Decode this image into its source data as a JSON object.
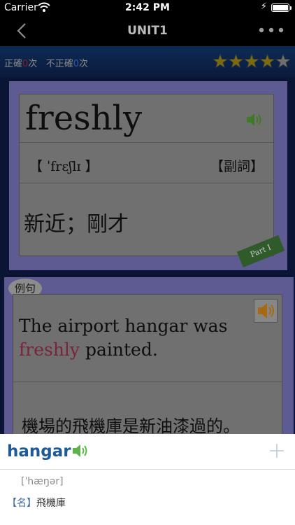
{
  "status": {
    "carrier": "Carrier",
    "time": "2:42 PM"
  },
  "nav": {
    "title": "UNIT1"
  },
  "score": {
    "correct_label": "正確",
    "correct_count": "0",
    "incorrect_label": "不正確",
    "incorrect_count": "0",
    "unit": "次",
    "stars_filled": 4,
    "stars_total": 5
  },
  "card": {
    "word": "freshly",
    "pronunciation": "【 ˈfrɛʃlɪ 】",
    "part_of_speech": "【副詞】",
    "meaning": "新近；剛才",
    "part_badge": "Part I"
  },
  "example": {
    "label": "例句",
    "sentence_before": "The airport hangar was ",
    "sentence_highlight": "freshly",
    "sentence_after": " painted.",
    "translation": "機場的飛機庫是新油漆過的。"
  },
  "popup": {
    "word": "hangar",
    "ipa": "[ˈhæŋər]",
    "pos_tag": "【名】",
    "meaning": "飛機庫"
  },
  "colors": {
    "accent": "#1e5a96",
    "highlight": "#7b2337",
    "card_frame": "#5e5b92",
    "speaker_green": "#3f9a2a",
    "star": "#c8a400"
  }
}
